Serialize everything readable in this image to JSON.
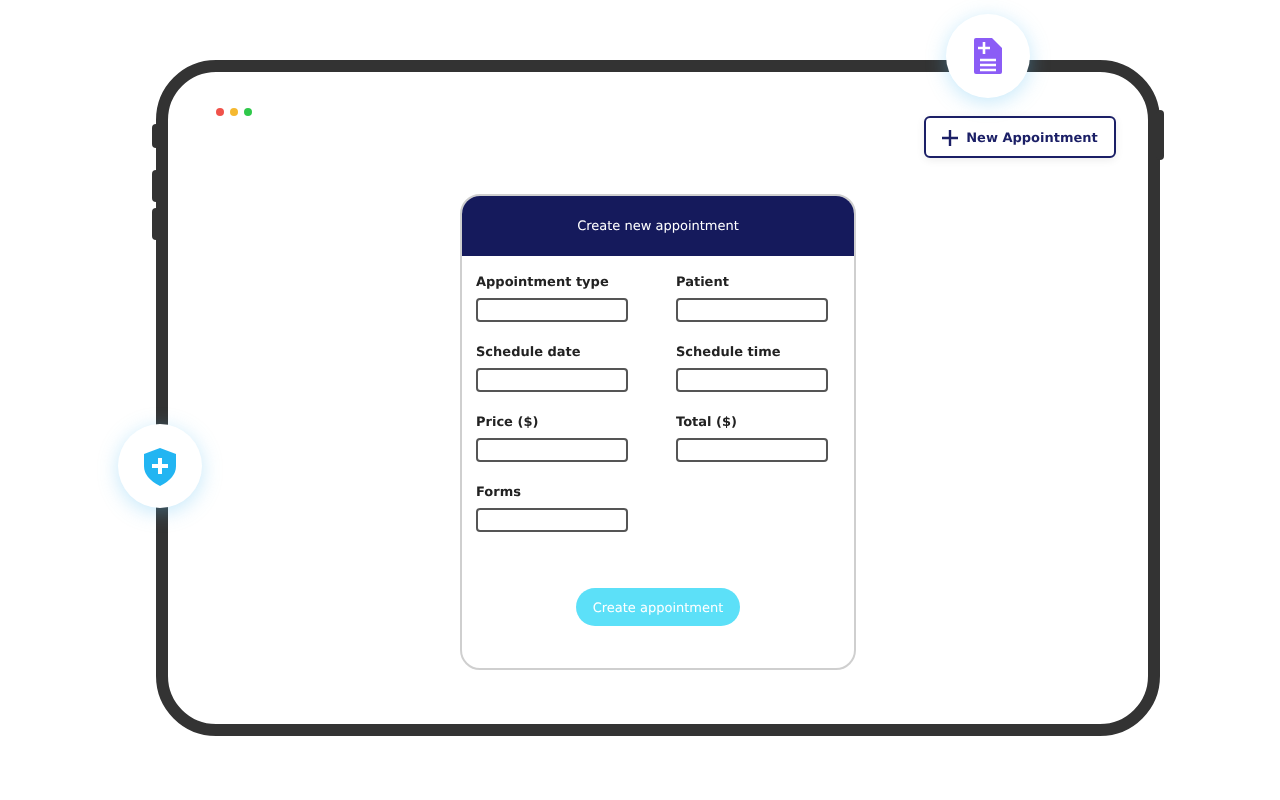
{
  "toolbar": {
    "new_button": {
      "label": "New Appointment"
    }
  },
  "form": {
    "title": "Create new appointment",
    "fields": [
      {
        "label": "Appointment type"
      },
      {
        "label": "Patient"
      },
      {
        "label": "Schedule date"
      },
      {
        "label": "Schedule time"
      },
      {
        "label": "Price ($)"
      },
      {
        "label": "Total ($)"
      },
      {
        "label": "Forms"
      }
    ],
    "submit": {
      "label": "Create appointment"
    }
  }
}
